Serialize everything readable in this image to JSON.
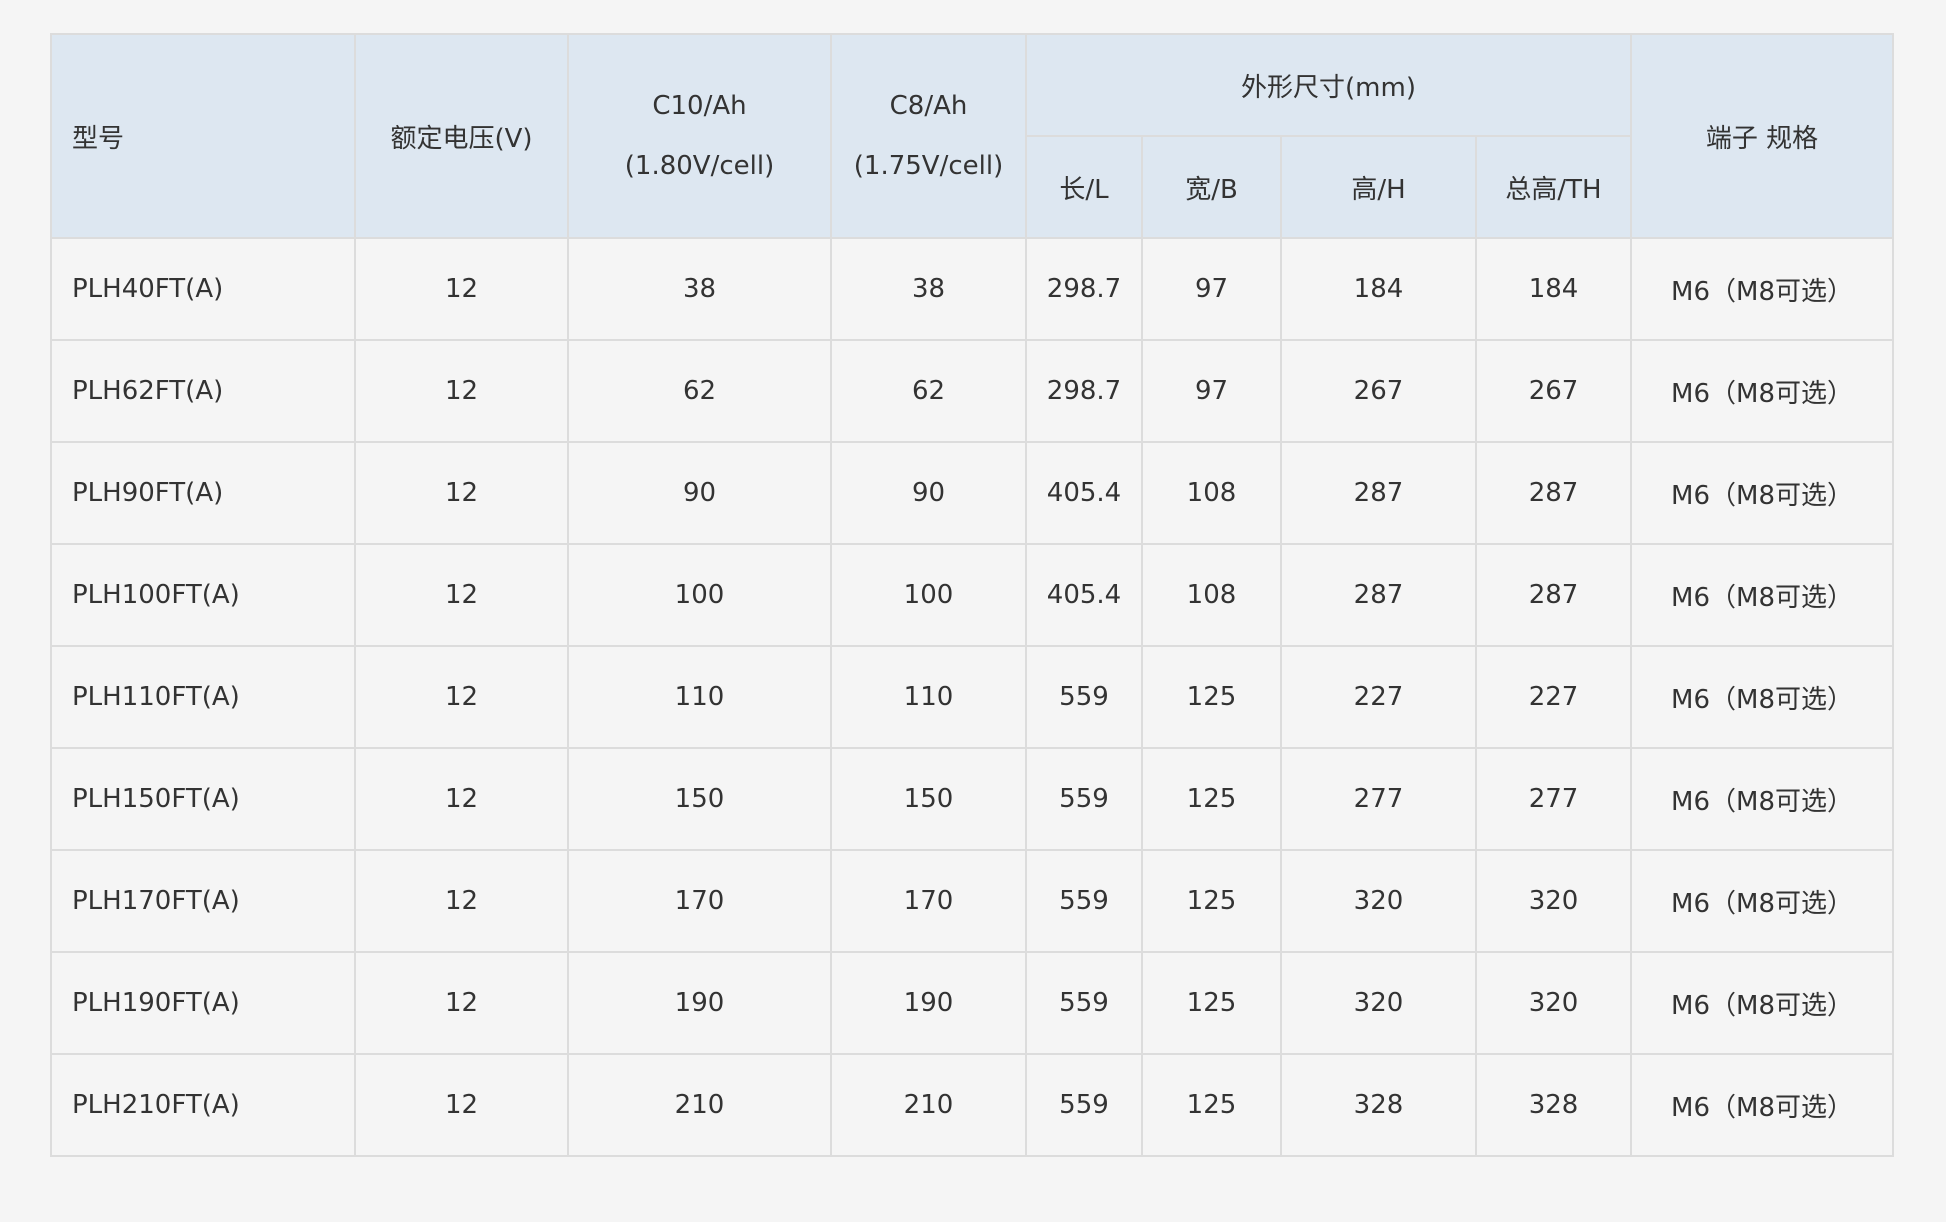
{
  "table": {
    "headers": {
      "model": "型号",
      "voltage": "额定电压(V)",
      "c10_line1": "C10/Ah",
      "c10_line2": "(1.80V/cell)",
      "c8_line1": "C8/Ah",
      "c8_line2": "(1.75V/cell)",
      "dimensions": "外形尺寸(mm)",
      "length": "长/L",
      "width": "宽/B",
      "height": "高/H",
      "total_height": "总高/TH",
      "terminal": "端子 规格"
    },
    "rows": [
      [
        "PLH40FT(A)",
        "12",
        "38",
        "38",
        "298.7",
        "97",
        "184",
        "184",
        "M6（M8可选）"
      ],
      [
        "PLH62FT(A)",
        "12",
        "62",
        "62",
        "298.7",
        "97",
        "267",
        "267",
        "M6（M8可选）"
      ],
      [
        "PLH90FT(A)",
        "12",
        "90",
        "90",
        "405.4",
        "108",
        "287",
        "287",
        "M6（M8可选）"
      ],
      [
        "PLH100FT(A)",
        "12",
        "100",
        "100",
        "405.4",
        "108",
        "287",
        "287",
        "M6（M8可选）"
      ],
      [
        "PLH110FT(A)",
        "12",
        "110",
        "110",
        "559",
        "125",
        "227",
        "227",
        "M6（M8可选）"
      ],
      [
        "PLH150FT(A)",
        "12",
        "150",
        "150",
        "559",
        "125",
        "277",
        "277",
        "M6（M8可选）"
      ],
      [
        "PLH170FT(A)",
        "12",
        "170",
        "170",
        "559",
        "125",
        "320",
        "320",
        "M6（M8可选）"
      ],
      [
        "PLH190FT(A)",
        "12",
        "190",
        "190",
        "559",
        "125",
        "320",
        "320",
        "M6（M8可选）"
      ],
      [
        "PLH210FT(A)",
        "12",
        "210",
        "210",
        "559",
        "125",
        "328",
        "328",
        "M6（M8可选）"
      ]
    ]
  },
  "colors": {
    "background": "#f5f5f5",
    "header_background": "#dde7f1",
    "border": "#dcdcdc",
    "text": "#333333"
  }
}
